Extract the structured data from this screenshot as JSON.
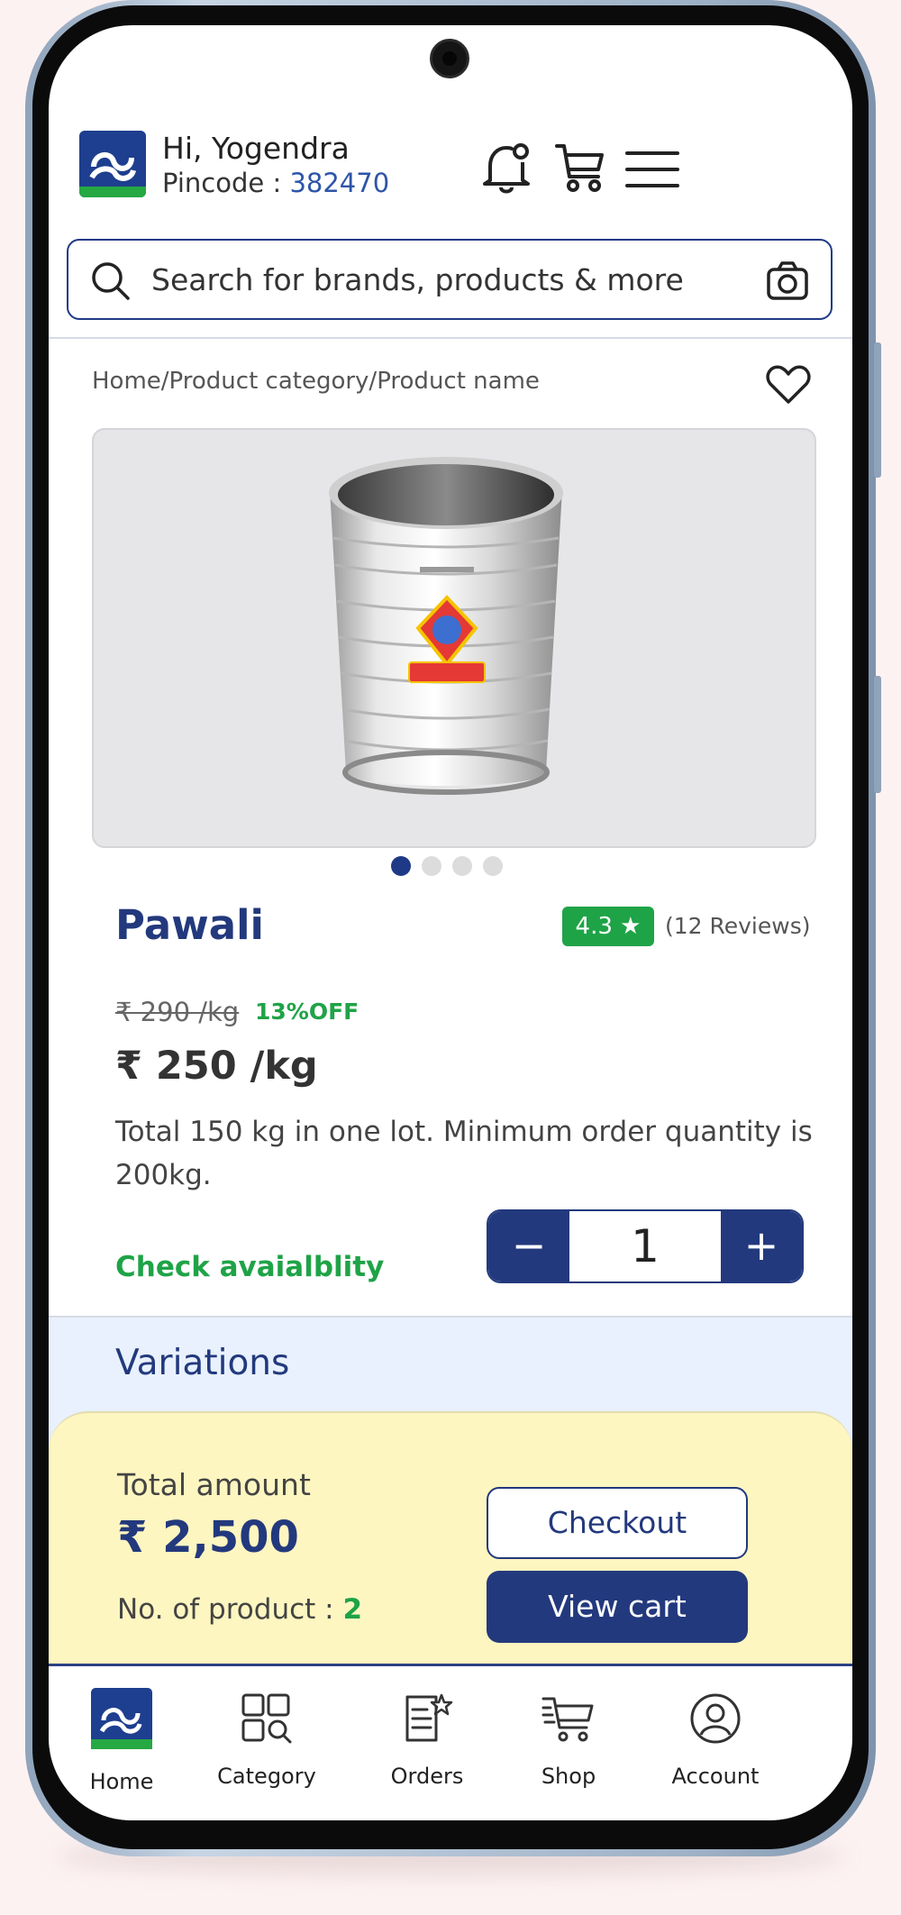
{
  "header": {
    "greeting": "Hi, Yogendra",
    "pincode_label": "Pincode :",
    "pincode_value": "382470",
    "icons": [
      "notification-bell-icon",
      "cart-icon",
      "menu-icon"
    ]
  },
  "search": {
    "placeholder": "Search for brands, products & more",
    "icons": [
      "search-icon",
      "camera-icon"
    ]
  },
  "breadcrumb": "Home/Product category/Product name",
  "product": {
    "name": "Pawali",
    "rating": "4.3 ★",
    "reviews": "(12 Reviews)",
    "old_price": "₹ 290 /kg",
    "discount": "13%OFF",
    "price": "₹ 250 /kg",
    "description": "Total 150 kg in one lot. Minimum order quantity is 200kg.",
    "check_availability": "Check avaialblity",
    "quantity": "1",
    "decrement": "−",
    "increment": "+",
    "carousel_pages": 4,
    "carousel_active": 1
  },
  "variations": {
    "title": "Variations"
  },
  "summary": {
    "total_label": "Total amount",
    "total_amount": "₹ 2,500",
    "count_label": "No. of product :",
    "count_value": "2",
    "checkout_label": "Checkout",
    "view_cart_label": "View cart"
  },
  "bottom_nav": {
    "items": [
      {
        "label": "Home",
        "icon": "home-logo-icon"
      },
      {
        "label": "Category",
        "icon": "category-grid-search-icon"
      },
      {
        "label": "Orders",
        "icon": "orders-list-icon"
      },
      {
        "label": "Shop",
        "icon": "shop-cart-icon"
      },
      {
        "label": "Account",
        "icon": "account-user-icon"
      }
    ]
  },
  "colors": {
    "brand_blue": "#23397d",
    "green": "#1fa347",
    "variations_bg": "#e8f1fd",
    "summary_bg": "#fef6c0"
  }
}
